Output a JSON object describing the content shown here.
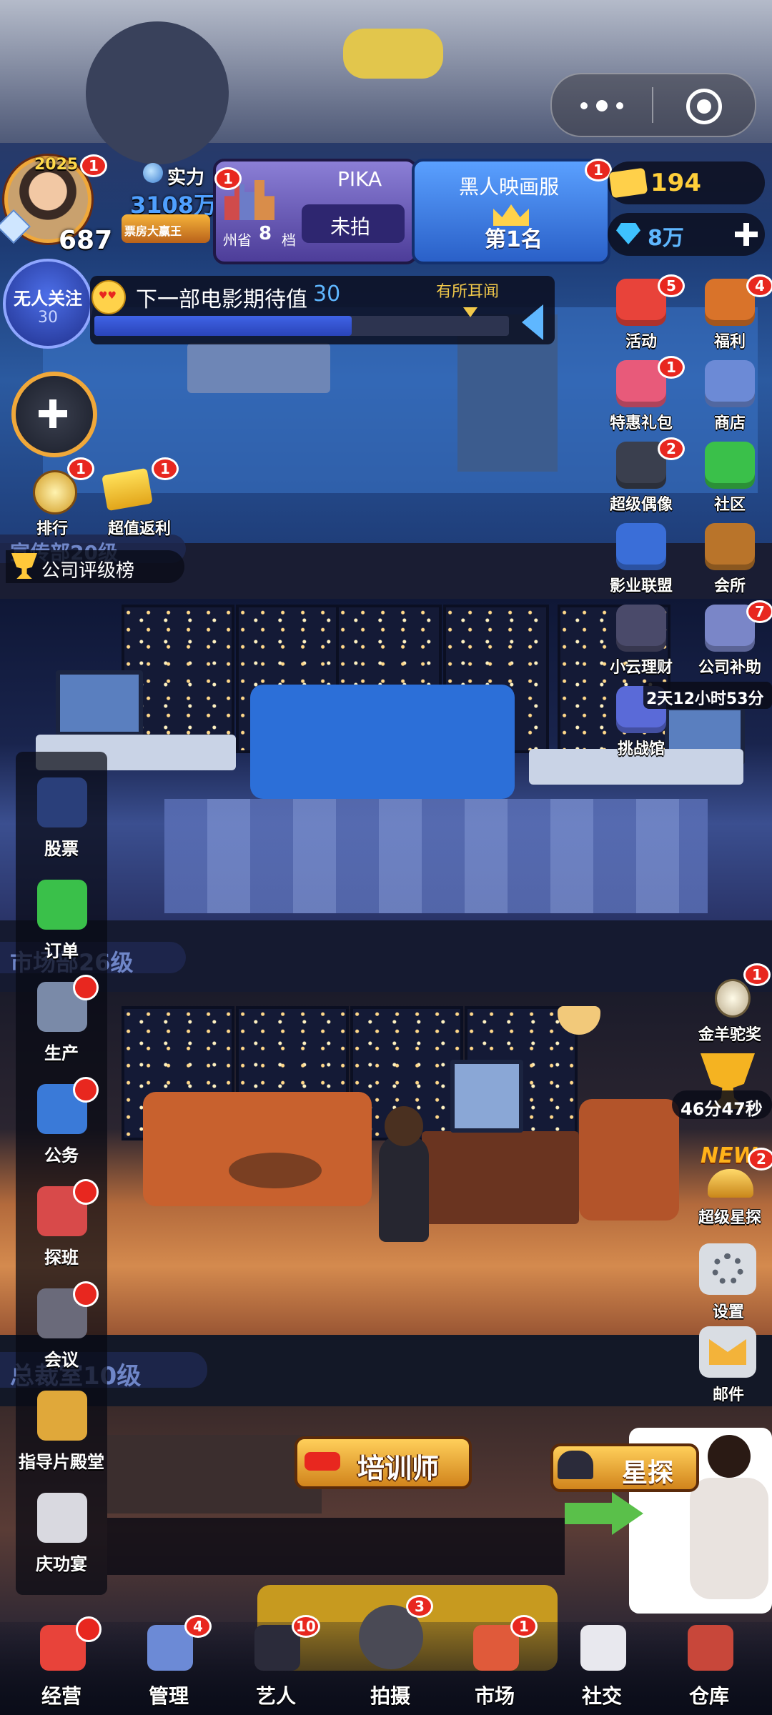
{
  "capsule": {
    "more_icon": "more-dots-icon",
    "close_icon": "target-circle-icon"
  },
  "profile": {
    "year": "2025",
    "level": "687",
    "badge": "1",
    "power_label": "实力",
    "power_value": "3108万",
    "title": "票房大赢王"
  },
  "project": {
    "badge": "1",
    "name": "PIKA",
    "region": "州省",
    "slot_number": "8",
    "slot_unit": "档",
    "status": "未拍"
  },
  "ranking": {
    "badge": "1",
    "server": "黑人映画服",
    "rank": "第1名"
  },
  "currency": {
    "tickets": "194",
    "diamonds": "8万",
    "add_icon": "plus-icon"
  },
  "follow": {
    "title": "无人关注",
    "value": "30"
  },
  "expectation": {
    "label": "下一部电影期待值",
    "value": "30",
    "stage": "有所耳闻",
    "progress": 0.62
  },
  "left_buttons": {
    "rank": {
      "label": "排行",
      "badge": "1"
    },
    "rebate": {
      "label": "超值返利",
      "badge": "1"
    },
    "company_rank": "公司评级榜"
  },
  "floors": {
    "f1": "宣传部20级",
    "f2": "市场部26级",
    "f3": "总裁室10级"
  },
  "right_buttons": [
    {
      "label": "活动",
      "badge": "5"
    },
    {
      "label": "福利",
      "badge": "4"
    },
    {
      "label": "特惠礼包",
      "badge": "1"
    },
    {
      "label": "商店",
      "badge": ""
    },
    {
      "label": "超级偶像",
      "badge": "2"
    },
    {
      "label": "社区",
      "badge": ""
    },
    {
      "label": "影业联盟",
      "badge": ""
    },
    {
      "label": "会所",
      "badge": ""
    },
    {
      "label": "小云理财",
      "badge": ""
    },
    {
      "label": "公司补助",
      "badge": "7"
    },
    {
      "label": "挑战馆",
      "badge": ""
    }
  ],
  "subsidy_timer": "2天12小时53分",
  "right_lower": {
    "golden_award": {
      "label": "金羊驼奖",
      "badge": "1",
      "timer": "46分47秒"
    },
    "star_scout": {
      "label": "超级星探",
      "new": "NEW",
      "badge": "2"
    },
    "settings": {
      "label": "设置"
    },
    "mail": {
      "label": "邮件"
    }
  },
  "left_menu": [
    {
      "label": "股票",
      "dot": false
    },
    {
      "label": "订单",
      "dot": false
    },
    {
      "label": "生产",
      "dot": true
    },
    {
      "label": "公务",
      "dot": true
    },
    {
      "label": "探班",
      "dot": true
    },
    {
      "label": "会议",
      "dot": true
    },
    {
      "label": "指导片殿堂",
      "dot": false
    },
    {
      "label": "庆功宴",
      "dot": false
    }
  ],
  "scene_labels": {
    "trainer": "培训师",
    "scout": "星探"
  },
  "bottom_nav": [
    {
      "label": "经营",
      "badge": ""
    },
    {
      "label": "管理",
      "badge": "4"
    },
    {
      "label": "艺人",
      "badge": "10"
    },
    {
      "label": "拍摄",
      "badge": "3"
    },
    {
      "label": "市场",
      "badge": "1"
    },
    {
      "label": "社交",
      "badge": ""
    },
    {
      "label": "仓库",
      "badge": ""
    }
  ],
  "colors": {
    "accent_blue": "#2a8cff",
    "badge_red": "#e8271f",
    "gold": "#ffcf3a",
    "panel_dark": "#1b1f3a"
  }
}
